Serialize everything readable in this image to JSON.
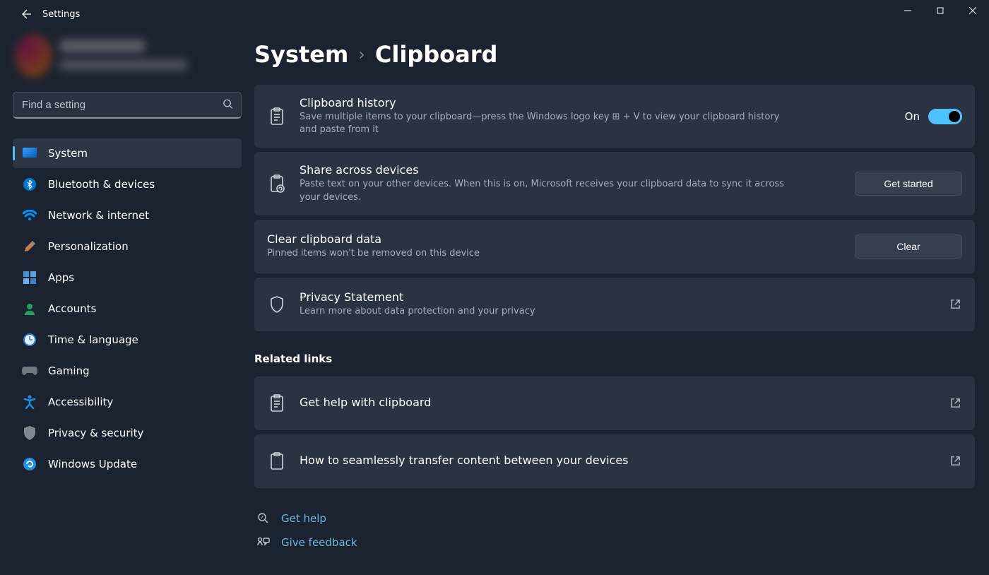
{
  "window": {
    "title": "Settings"
  },
  "search": {
    "placeholder": "Find a setting"
  },
  "sidebar": {
    "items": [
      {
        "label": "System",
        "active": true
      },
      {
        "label": "Bluetooth & devices",
        "active": false
      },
      {
        "label": "Network & internet",
        "active": false
      },
      {
        "label": "Personalization",
        "active": false
      },
      {
        "label": "Apps",
        "active": false
      },
      {
        "label": "Accounts",
        "active": false
      },
      {
        "label": "Time & language",
        "active": false
      },
      {
        "label": "Gaming",
        "active": false
      },
      {
        "label": "Accessibility",
        "active": false
      },
      {
        "label": "Privacy & security",
        "active": false
      },
      {
        "label": "Windows Update",
        "active": false
      }
    ]
  },
  "breadcrumb": {
    "parent": "System",
    "current": "Clipboard"
  },
  "cards": {
    "history": {
      "title": "Clipboard history",
      "desc": "Save multiple items to your clipboard—press the Windows logo key ⊞ + V to view your clipboard history and paste from it",
      "toggle_label": "On"
    },
    "share": {
      "title": "Share across devices",
      "desc": "Paste text on your other devices. When this is on, Microsoft receives your clipboard data to sync it across your devices.",
      "button": "Get started"
    },
    "clear": {
      "title": "Clear clipboard data",
      "desc": "Pinned items won't be removed on this device",
      "button": "Clear"
    },
    "privacy": {
      "title": "Privacy Statement",
      "desc": "Learn more about data protection and your privacy"
    }
  },
  "related": {
    "label": "Related links",
    "items": [
      {
        "title": "Get help with clipboard"
      },
      {
        "title": "How to seamlessly transfer content between your devices"
      }
    ]
  },
  "footer": {
    "help": "Get help",
    "feedback": "Give feedback"
  }
}
